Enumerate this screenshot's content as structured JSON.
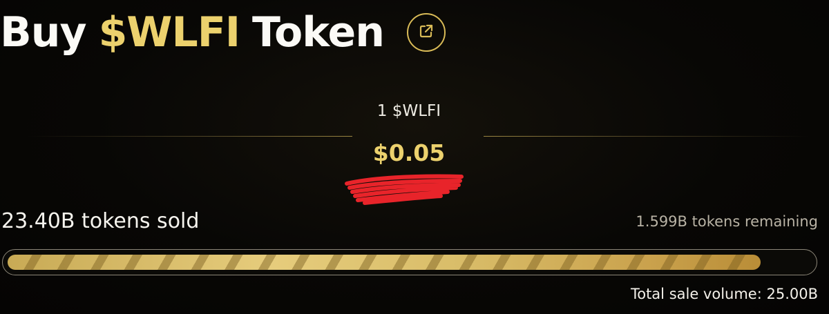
{
  "header": {
    "title_prefix": "Buy",
    "title_token": "$WLFI",
    "title_suffix": "Token",
    "external_link_icon": "external-link-icon"
  },
  "price": {
    "unit_label": "1 $WLFI",
    "value": "$0.05"
  },
  "sale": {
    "sold_label": "23.40B tokens sold",
    "remaining_label": "1.599B tokens remaining",
    "total_label": "Total sale volume: 25.00B",
    "progress_fraction": 0.936
  },
  "colors": {
    "accent": "#ecd16d",
    "background": "#070604",
    "redaction": "#e8242a"
  }
}
